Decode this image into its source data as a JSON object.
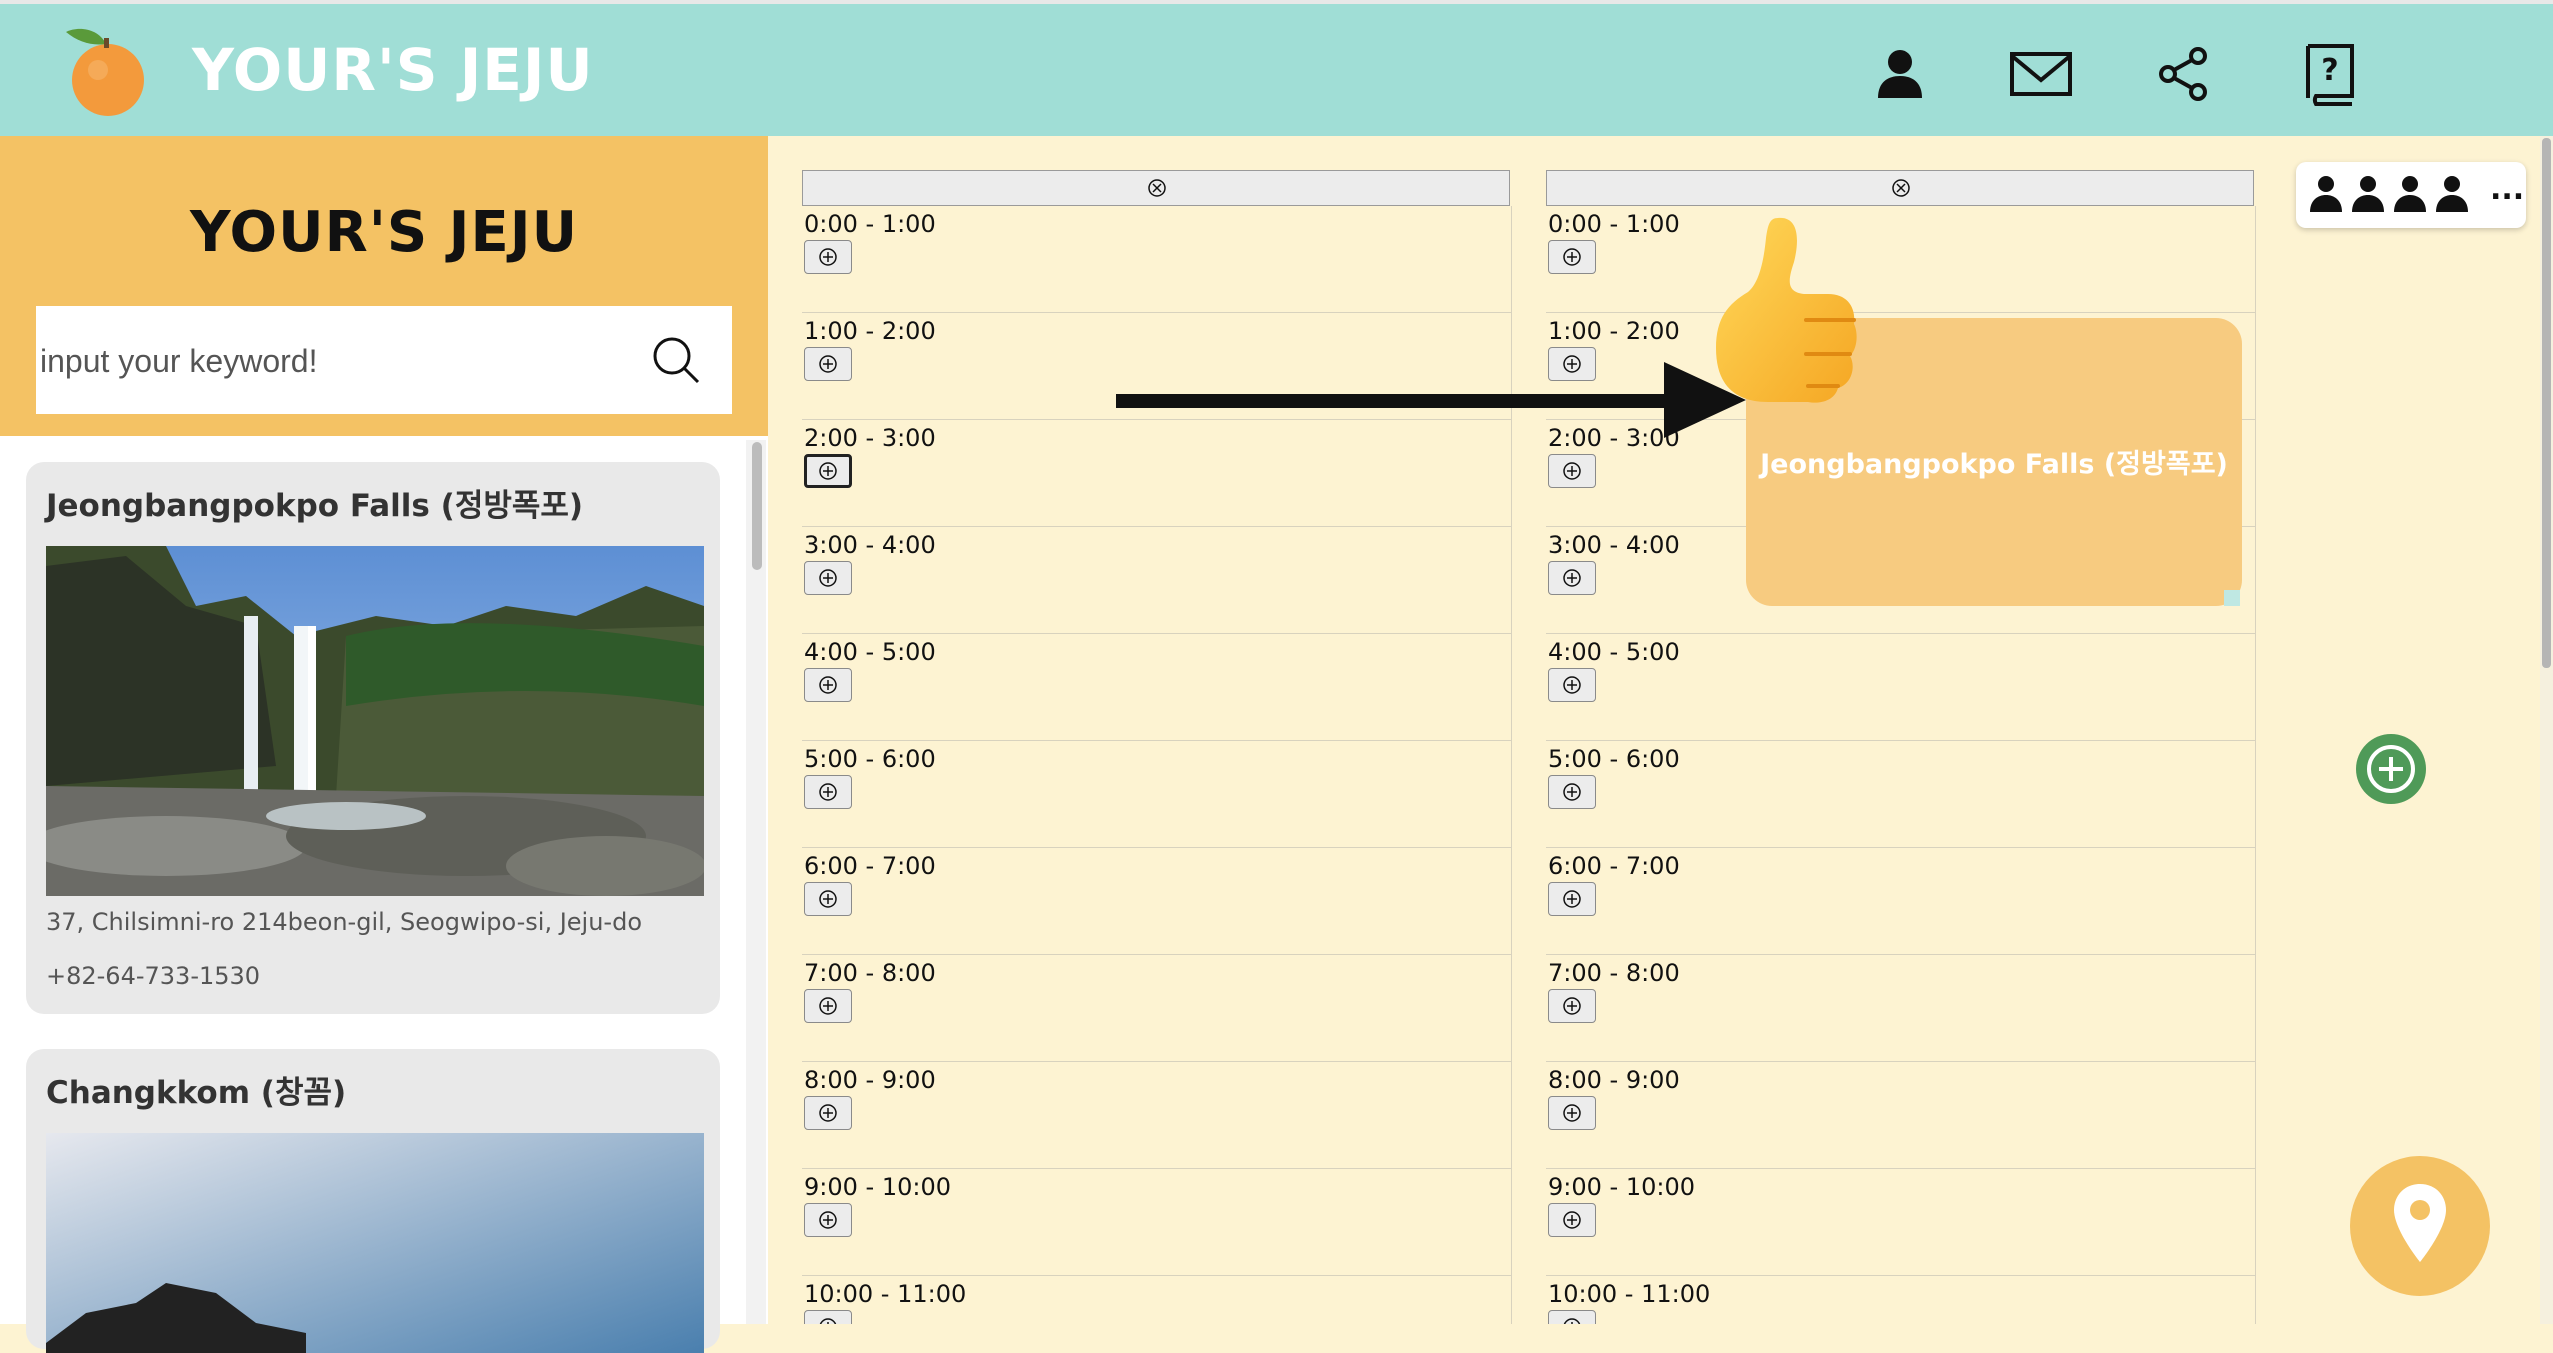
{
  "app": {
    "brand": "YOUR'S JEJU",
    "nav_icons": [
      "user-icon",
      "mail-icon",
      "share-icon",
      "help-book-icon"
    ]
  },
  "sidebar": {
    "title": "YOUR'S JEJU",
    "search_placeholder": "input your keyword!",
    "places": [
      {
        "name": "Jeongbangpokpo Falls (정방폭포)",
        "address": "37, Chilsimni-ro 214beon-gil, Seogwipo-si, Jeju-do",
        "phone": "+82-64-733-1530"
      },
      {
        "name": "Changkkom (창꼼)"
      }
    ]
  },
  "schedule": {
    "columns": [
      {
        "slots": [
          "0:00 - 1:00",
          "1:00 - 2:00",
          "2:00 - 3:00",
          "3:00 - 4:00",
          "4:00 - 5:00",
          "5:00 - 6:00",
          "6:00 - 7:00",
          "7:00 - 8:00",
          "8:00 - 9:00",
          "9:00 - 10:00",
          "10:00 - 11:00"
        ]
      },
      {
        "slots": [
          "0:00 - 1:00",
          "1:00 - 2:00",
          "2:00 - 3:00",
          "3:00 - 4:00",
          "4:00 - 5:00",
          "5:00 - 6:00",
          "6:00 - 7:00",
          "7:00 - 8:00",
          "8:00 - 9:00",
          "9:00 - 10:00",
          "10:00 - 11:00"
        ]
      }
    ],
    "event": {
      "label": "Jeongbangpokpo Falls (정방폭포)"
    }
  },
  "members": {
    "count_icons": 4,
    "more": "..."
  },
  "colors": {
    "topbar": "#a0ded6",
    "accent": "#f4c264",
    "board": "#fdf3d2",
    "event": "#f7cb80",
    "add_button": "#4f9a58"
  }
}
